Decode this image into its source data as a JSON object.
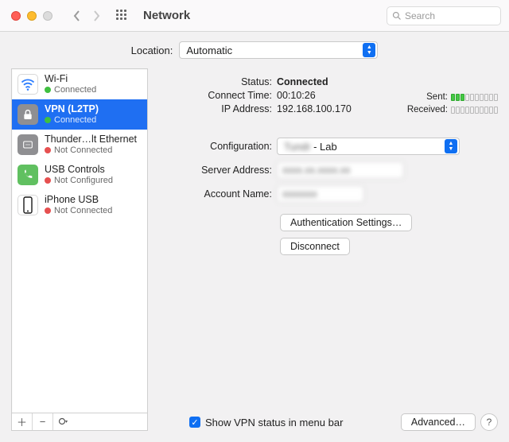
{
  "titlebar": {
    "title": "Network",
    "search_placeholder": "Search"
  },
  "location": {
    "label": "Location:",
    "value": "Automatic"
  },
  "sidebar": {
    "items": [
      {
        "name": "Wi-Fi",
        "status": "Connected",
        "dot": "green",
        "icon": "wifi",
        "iconbg": "#ffffff",
        "iconfg": "#2d7eff"
      },
      {
        "name": "VPN (L2TP)",
        "status": "Connected",
        "dot": "green",
        "icon": "lock",
        "iconbg": "#8f8f92",
        "iconfg": "#ffffff",
        "selected": true
      },
      {
        "name": "Thunder…lt Ethernet",
        "status": "Not Connected",
        "dot": "red",
        "icon": "ethernet",
        "iconbg": "#8f8f92",
        "iconfg": "#ffffff"
      },
      {
        "name": "USB Controls",
        "status": "Not Configured",
        "dot": "red",
        "icon": "phone",
        "iconbg": "#60c060",
        "iconfg": "#ffffff"
      },
      {
        "name": "iPhone USB",
        "status": "Not Connected",
        "dot": "red",
        "icon": "iphone",
        "iconbg": "#ffffff",
        "iconfg": "#1a1a1a"
      }
    ]
  },
  "status": {
    "status_label": "Status:",
    "status_value": "Connected",
    "connect_time_label": "Connect Time:",
    "connect_time_value": "00:10:26",
    "ip_label": "IP Address:",
    "ip_value": "192.168.100.170",
    "sent_label": "Sent:",
    "received_label": "Received:"
  },
  "form": {
    "configuration_label": "Configuration:",
    "configuration_value_prefix": "Tundr",
    "configuration_value_suffix": "- Lab",
    "server_label": "Server Address:",
    "server_value": "xxxx.xx.xxxx.xx",
    "account_label": "Account Name:",
    "account_value": "xxxxxxx"
  },
  "buttons": {
    "auth": "Authentication Settings…",
    "disconnect": "Disconnect",
    "advanced": "Advanced…"
  },
  "footer": {
    "checkbox_label": "Show VPN status in menu bar",
    "checked": true
  }
}
